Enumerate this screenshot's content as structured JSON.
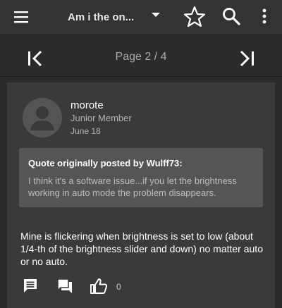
{
  "header": {
    "title": "Am i the on...",
    "icons": [
      "menu-icon",
      "dropdown-arrow-icon",
      "star-icon",
      "search-icon",
      "more-vertical-icon"
    ]
  },
  "pager": {
    "label": "Page 2 / 4",
    "icons": [
      "first-page-icon",
      "last-page-icon"
    ]
  },
  "post": {
    "username": "morote",
    "rank": "Junior Member",
    "date": "June 18",
    "quote": {
      "header": "Quote originally posted by Wulff73:",
      "text": "I think it's a software issue...if you let the brightness working in auto mode the problem disappears."
    },
    "body": "Mine is flickering when brightness is set to low (about 1/4-th of the brightness slider and down) no matter auto or no auto.",
    "like_count": "0",
    "action_icons": [
      "reply-icon",
      "quote-reply-icon",
      "thumbs-up-icon"
    ]
  },
  "colors": {
    "background": "#2b2b2b",
    "toolbar": "#333333",
    "card": "#3a3a3a",
    "quote_box": "#555555",
    "text_secondary": "#b3b3b3"
  }
}
